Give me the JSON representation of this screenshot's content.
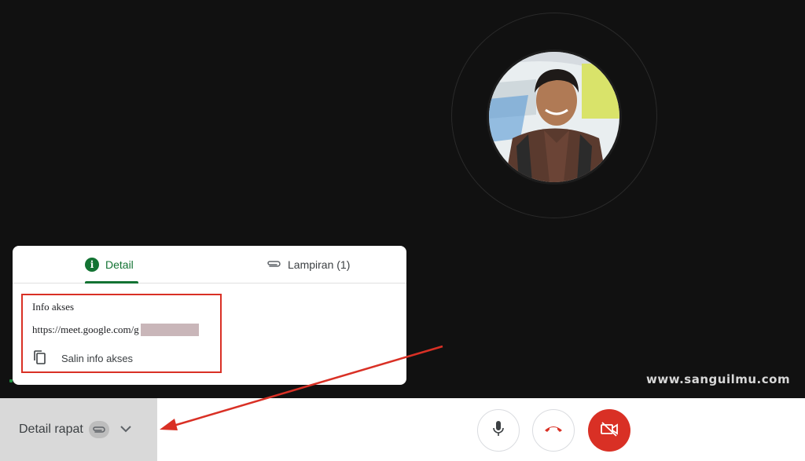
{
  "watermark": "www.sanguilmu.com",
  "panel": {
    "tabs": [
      {
        "label": "Detail",
        "icon": "info-icon",
        "active": true
      },
      {
        "label": "Lampiran (1)",
        "icon": "attachment-icon",
        "active": false
      }
    ],
    "access_info_title": "Info akses",
    "meeting_link": "https://meet.google.com/g",
    "copy_label": "Salin info akses"
  },
  "bottom_bar": {
    "details_label": "Detail rapat",
    "controls": [
      {
        "name": "microphone",
        "icon": "mic-icon"
      },
      {
        "name": "leave-call",
        "icon": "hangup-icon"
      },
      {
        "name": "camera",
        "icon": "camera-off-icon",
        "state": "off"
      }
    ]
  },
  "colors": {
    "accent_green": "#137333",
    "alert_red": "#d93025",
    "stage_bg": "#111111"
  }
}
